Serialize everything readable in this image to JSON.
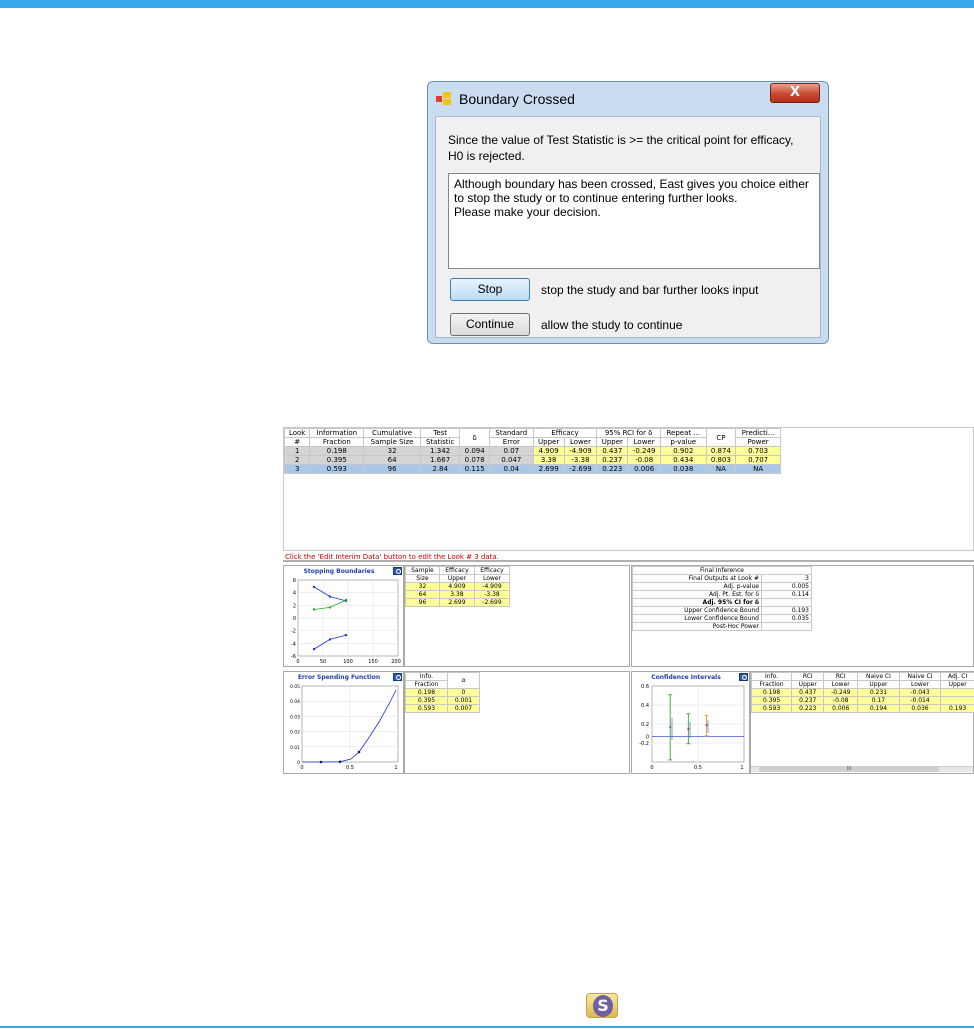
{
  "dialog": {
    "title": "Boundary Crossed",
    "close_label": "X",
    "message_lines": [
      "Since the value of Test Statistic is >= the critical point for efficacy,",
      "H0 is rejected."
    ],
    "info_lines": [
      "Although boundary has been crossed, East gives you choice either",
      "to stop the study or to continue entering further looks.",
      "Please make your decision."
    ],
    "stop_label": "Stop",
    "stop_desc": "stop the study and bar further looks input",
    "continue_label": "Continue",
    "continue_desc": "allow the study to continue"
  },
  "main_table": {
    "headers_top": [
      "Look",
      "Information",
      "Cumulative",
      "Test",
      "δ",
      "Standard",
      "Efficacy",
      "95% RCI for δ",
      "Repeat ...",
      "CP",
      "Predicti..."
    ],
    "headers_bottom": [
      "#",
      "Fraction",
      "Sample Size",
      "Statistic",
      "",
      "Error",
      "Upper",
      "Lower",
      "Upper",
      "Lower",
      "p-value",
      "",
      "Power"
    ],
    "rows": [
      [
        "1",
        "0.198",
        "32",
        "1.342",
        "0.094",
        "0.07",
        "4.909",
        "-4.909",
        "0.437",
        "-0.249",
        "0.902",
        "0.874",
        "0.703"
      ],
      [
        "2",
        "0.395",
        "64",
        "1.667",
        "0.078",
        "0.047",
        "3.38",
        "-3.38",
        "0.237",
        "-0.08",
        "0.434",
        "0.803",
        "0.707"
      ],
      [
        "3",
        "0.593",
        "96",
        "2.84",
        "0.115",
        "0.04",
        "2.699",
        "-2.699",
        "0.223",
        "0.006",
        "0.038",
        "NA",
        "NA"
      ]
    ],
    "hint": "Click the 'Edit Interim Data' button to edit the Look # 3 data."
  },
  "stopping": {
    "title": "Stopping Boundaries",
    "headers_top": [
      "Sample",
      "Efficacy",
      "Efficacy"
    ],
    "headers_bottom": [
      "Size",
      "Upper",
      "Lower"
    ],
    "rows": [
      [
        "32",
        "4.909",
        "-4.909"
      ],
      [
        "64",
        "3.38",
        "-3.38"
      ],
      [
        "96",
        "2.699",
        "-2.699"
      ]
    ],
    "yticks": [
      "6",
      "4",
      "2",
      "0",
      "-2",
      "-4",
      "-6"
    ],
    "xticks": [
      "0",
      "50",
      "100",
      "150",
      "200"
    ]
  },
  "final": {
    "title": "Final Inference",
    "rows": [
      [
        "Final Outputs at Look #",
        "3"
      ],
      [
        "Adj. p-value",
        "0.005"
      ],
      [
        "Adj. Pt. Est. for δ",
        "0.114"
      ],
      [
        "Adj. 95% CI for δ",
        ""
      ],
      [
        "Upper Confidence Bound",
        "0.193"
      ],
      [
        "Lower Confidence Bound",
        "0.035"
      ],
      [
        "Post-Hoc Power",
        ""
      ]
    ]
  },
  "error_spending": {
    "title": "Error Spending Function",
    "headers_top": [
      "Info.",
      "α"
    ],
    "headers_bottom": [
      "Fraction",
      ""
    ],
    "rows": [
      [
        "0.198",
        "0"
      ],
      [
        "0.395",
        "0.001"
      ],
      [
        "0.593",
        "0.007"
      ]
    ],
    "yticks": [
      "0.05",
      "0.04",
      "0.03",
      "0.02",
      "0.01",
      "0"
    ],
    "xticks": [
      "0",
      "0.5",
      "1"
    ]
  },
  "confidence": {
    "title": "Confidence Intervals",
    "headers_top": [
      "Info.",
      "RCI",
      "RCI",
      "Naive CI",
      "Naive CI",
      "Adj. CI"
    ],
    "headers_bottom": [
      "Fraction",
      "Upper",
      "Lower",
      "Upper",
      "Lower",
      "Upper"
    ],
    "rows": [
      [
        "0.198",
        "0.437",
        "-0.249",
        "0.231",
        "-0.043",
        ""
      ],
      [
        "0.395",
        "0.237",
        "-0.08",
        "0.17",
        "-0.014",
        ""
      ],
      [
        "0.593",
        "0.223",
        "0.006",
        "0.194",
        "0.036",
        "0.193"
      ]
    ],
    "yticks": [
      "0.6",
      "0.4",
      "0.2",
      "0",
      "-0.2"
    ],
    "xticks": [
      "0",
      "0.5",
      "1"
    ],
    "scroll_label": "III"
  },
  "logo_letter": "S",
  "colors": {
    "accent": "#3aa7e8",
    "highlight": "#ffff99",
    "selected_row": "#a9c7e8",
    "hint": "#cc0000"
  }
}
